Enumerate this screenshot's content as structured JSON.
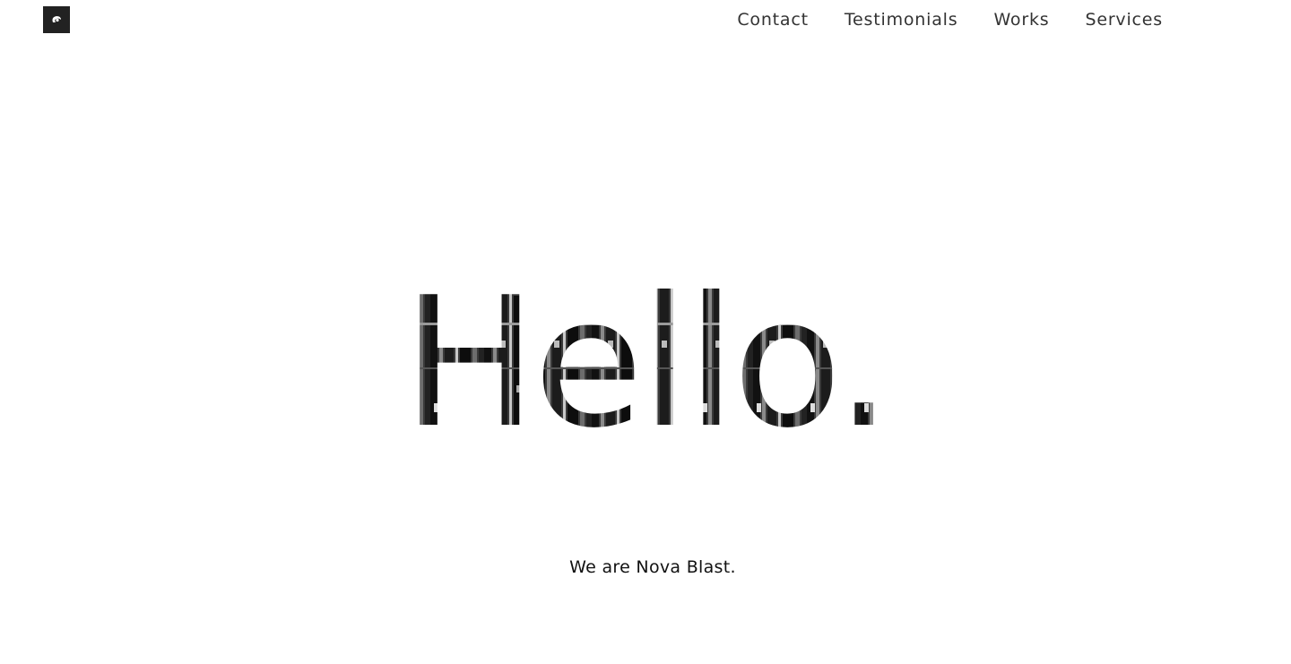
{
  "header": {
    "logo_icon": "swirl-logo-icon",
    "nav": [
      {
        "label": "Contact"
      },
      {
        "label": "Testimonials"
      },
      {
        "label": "Works"
      },
      {
        "label": "Services"
      }
    ]
  },
  "hero": {
    "headline": "Hello.",
    "tagline": "We are Nova Blast."
  },
  "colors": {
    "text": "#333333",
    "logo_bg": "#222222",
    "background": "#ffffff"
  }
}
